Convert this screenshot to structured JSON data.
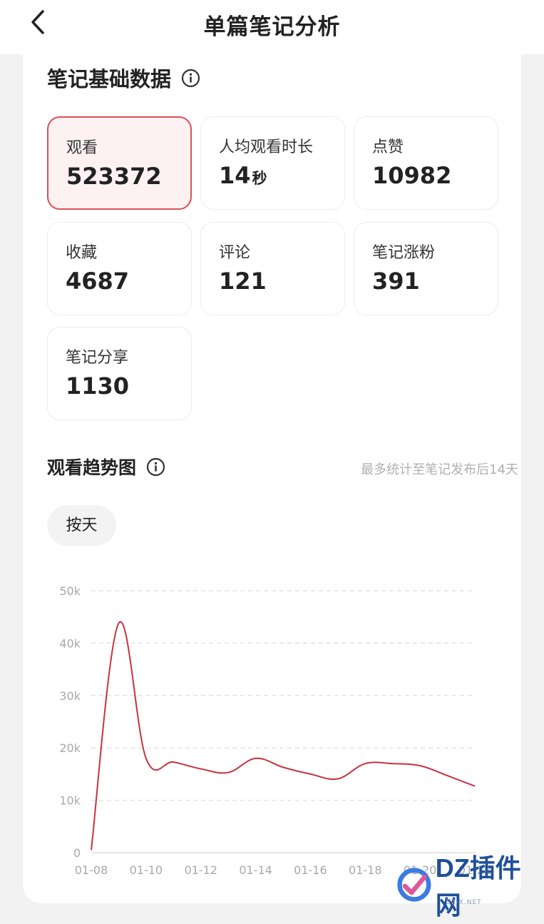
{
  "header": {
    "title": "单篇笔记分析"
  },
  "basic": {
    "title": "笔记基础数据",
    "stats": [
      {
        "label": "观看",
        "value": "523372",
        "unit": "",
        "active": true
      },
      {
        "label": "人均观看时长",
        "value": "14",
        "unit": "秒",
        "active": false
      },
      {
        "label": "点赞",
        "value": "10982",
        "unit": "",
        "active": false
      },
      {
        "label": "收藏",
        "value": "4687",
        "unit": "",
        "active": false
      },
      {
        "label": "评论",
        "value": "121",
        "unit": "",
        "active": false
      },
      {
        "label": "笔记涨粉",
        "value": "391",
        "unit": "",
        "active": false
      },
      {
        "label": "笔记分享",
        "value": "1130",
        "unit": "",
        "active": false
      }
    ]
  },
  "trend": {
    "title": "观看趋势图",
    "note": "最多统计至笔记发布后14天",
    "range_label": "按天"
  },
  "watermark": {
    "text": "DZ插件网",
    "sub": "DZ-X.NET"
  },
  "colors": {
    "accent": "#d9505a",
    "line": "#c8323f",
    "grid": "#e2e2e2"
  },
  "chart_data": {
    "type": "line",
    "title": "",
    "xlabel": "",
    "ylabel": "",
    "ylim": [
      0,
      50000
    ],
    "yticks": [
      0,
      10000,
      20000,
      30000,
      40000,
      50000
    ],
    "ytick_labels": [
      "0",
      "10k",
      "20k",
      "30k",
      "40k",
      "50k"
    ],
    "xtick_labels": [
      "01-08",
      "01-10",
      "01-12",
      "01-14",
      "01-16",
      "01-18",
      "01-20",
      "01-22"
    ],
    "grid": true,
    "series": [
      {
        "x": [
          "01-08",
          "01-09",
          "01-10",
          "01-11",
          "01-12",
          "01-13",
          "01-14",
          "01-15",
          "01-16",
          "01-17",
          "01-18",
          "01-19",
          "01-20",
          "01-21",
          "01-22"
        ],
        "values": [
          500,
          43800,
          18000,
          17300,
          16000,
          15300,
          18000,
          16300,
          15000,
          14100,
          17000,
          17000,
          16600,
          14700,
          12700
        ]
      }
    ]
  }
}
